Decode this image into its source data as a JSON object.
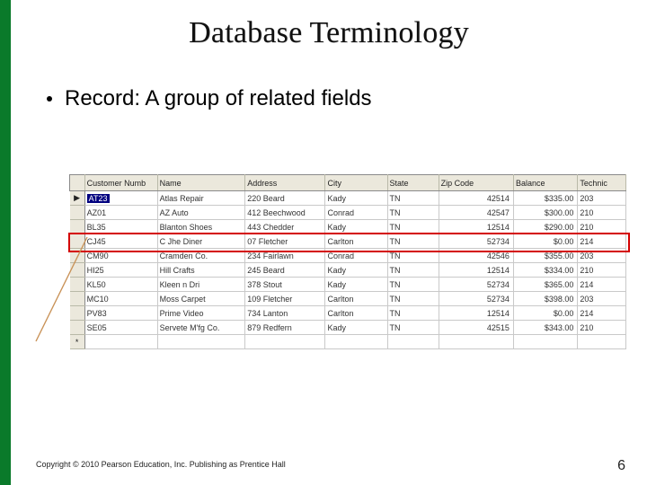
{
  "title": "Database Terminology",
  "bullet": "Record: A group of related fields",
  "headers": [
    "Customer Numb",
    "Name",
    "Address",
    "City",
    "State",
    "Zip Code",
    "Balance",
    "Technic"
  ],
  "rows": [
    {
      "sel": "▶",
      "cn": "AT23",
      "name": "Atlas Repair",
      "addr": "220 Beard",
      "city": "Kady",
      "state": "TN",
      "zip": "42514",
      "bal": "$335.00",
      "tech": "203"
    },
    {
      "sel": "",
      "cn": "AZ01",
      "name": "AZ Auto",
      "addr": "412 Beechwood",
      "city": "Conrad",
      "state": "TN",
      "zip": "42547",
      "bal": "$300.00",
      "tech": "210"
    },
    {
      "sel": "",
      "cn": "BL35",
      "name": "Blanton Shoes",
      "addr": "443 Chedder",
      "city": "Kady",
      "state": "TN",
      "zip": "12514",
      "bal": "$290.00",
      "tech": "210"
    },
    {
      "sel": "",
      "cn": "CJ45",
      "name": "C Jhe Diner",
      "addr": "07 Fletcher",
      "city": "Carlton",
      "state": "TN",
      "zip": "52734",
      "bal": "$0.00",
      "tech": "214"
    },
    {
      "sel": "",
      "cn": "CM90",
      "name": "Cramden Co.",
      "addr": "234 Fairlawn",
      "city": "Conrad",
      "state": "TN",
      "zip": "42546",
      "bal": "$355.00",
      "tech": "203"
    },
    {
      "sel": "",
      "cn": "HI25",
      "name": "Hill Crafts",
      "addr": "245 Beard",
      "city": "Kady",
      "state": "TN",
      "zip": "12514",
      "bal": "$334.00",
      "tech": "210"
    },
    {
      "sel": "",
      "cn": "KL50",
      "name": "Kleen n Dri",
      "addr": "378 Stout",
      "city": "Kady",
      "state": "TN",
      "zip": "52734",
      "bal": "$365.00",
      "tech": "214"
    },
    {
      "sel": "",
      "cn": "MC10",
      "name": "Moss Carpet",
      "addr": "109 Fletcher",
      "city": "Carlton",
      "state": "TN",
      "zip": "52734",
      "bal": "$398.00",
      "tech": "203"
    },
    {
      "sel": "",
      "cn": "PV83",
      "name": "Prime Video",
      "addr": "734 Lanton",
      "city": "Carlton",
      "state": "TN",
      "zip": "12514",
      "bal": "$0.00",
      "tech": "214"
    },
    {
      "sel": "",
      "cn": "SE05",
      "name": "Servete M'fg Co.",
      "addr": "879 Redfern",
      "city": "Kady",
      "state": "TN",
      "zip": "42515",
      "bal": "$343.00",
      "tech": "210"
    }
  ],
  "newrow_marker": "*",
  "highlight_row_index": 3,
  "copyright": "Copyright © 2010 Pearson Education, Inc. Publishing as Prentice Hall",
  "page_number": "6"
}
